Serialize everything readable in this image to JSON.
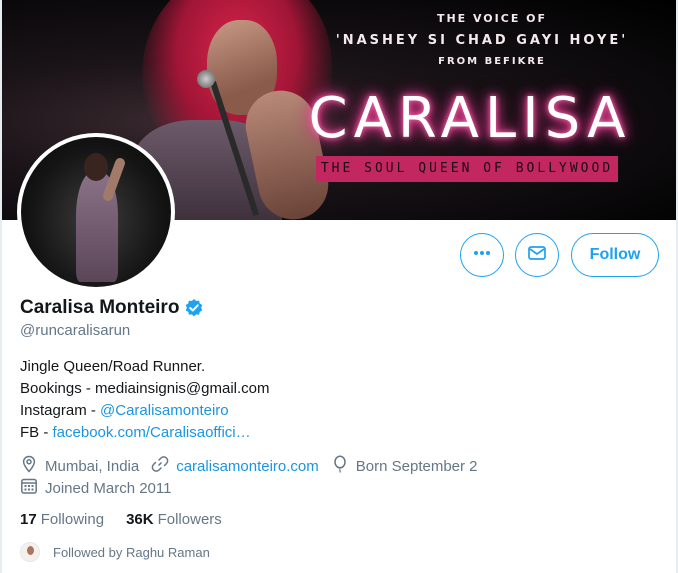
{
  "banner": {
    "voice_line": "THE VOICE OF",
    "song_line": "'NASHEY SI CHAD GAYI  HOYE'",
    "from_line": "FROM BEFIKRE",
    "name_line": "CARALISA",
    "tagline": "THE SOUL QUEEN OF BOLLYWOOD"
  },
  "actions": {
    "more_icon": "more-horizontal-icon",
    "message_icon": "envelope-icon",
    "follow_label": "Follow"
  },
  "profile": {
    "display_name": "Caralisa Monteiro",
    "verified_icon": "verified-badge-icon",
    "handle": "@runcaralisarun"
  },
  "bio": {
    "line1": "Jingle Queen/Road Runner.",
    "line2": "Bookings - mediainsignis@gmail.com",
    "line3_prefix": "Instagram - ",
    "line3_link": "@Caralisamonteiro",
    "line4_prefix": "FB - ",
    "line4_link": "facebook.com/Caralisaoffici…"
  },
  "meta": {
    "location": "Mumbai, India",
    "website": "caralisamonteiro.com",
    "birthday": "Born September 2",
    "joined": "Joined March 2011"
  },
  "stats": {
    "following_count": "17",
    "following_label": "Following",
    "followers_count": "36K",
    "followers_label": "Followers"
  },
  "followed_by": {
    "text": "Followed by Raghu Raman"
  },
  "colors": {
    "accent": "#1da1f2",
    "link": "#1b95e0",
    "muted": "#657786",
    "tagline_bg": "#c2285f"
  }
}
